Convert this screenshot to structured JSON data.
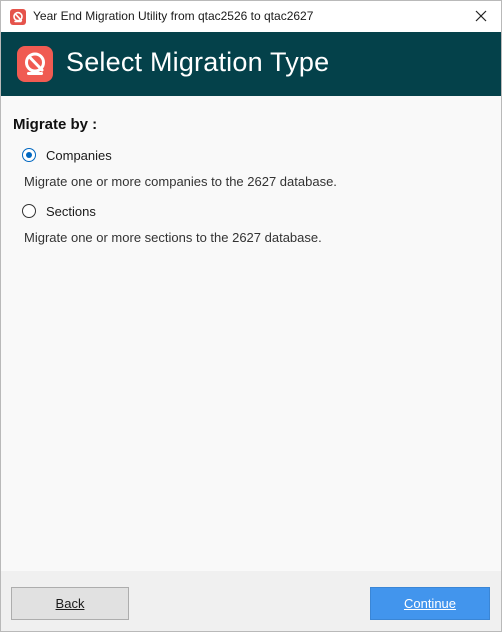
{
  "window": {
    "title": "Year End Migration Utility from qtac2526 to qtac2627",
    "close_icon": "close-icon",
    "app_icon": "app-logo-icon"
  },
  "header": {
    "title": "Select Migration Type",
    "logo_icon": "app-logo-icon",
    "background_color": "#04414a",
    "logo_color": "#f05b52"
  },
  "content": {
    "migrate_by_label": "Migrate by :",
    "options": [
      {
        "label": "Companies",
        "description": "Migrate one or more companies to the 2627 database.",
        "selected": true
      },
      {
        "label": "Sections",
        "description": "Migrate one or more sections to the 2627 database.",
        "selected": false
      }
    ]
  },
  "footer": {
    "back_label": "Back",
    "continue_label": "Continue",
    "continue_color": "#4295ed"
  }
}
